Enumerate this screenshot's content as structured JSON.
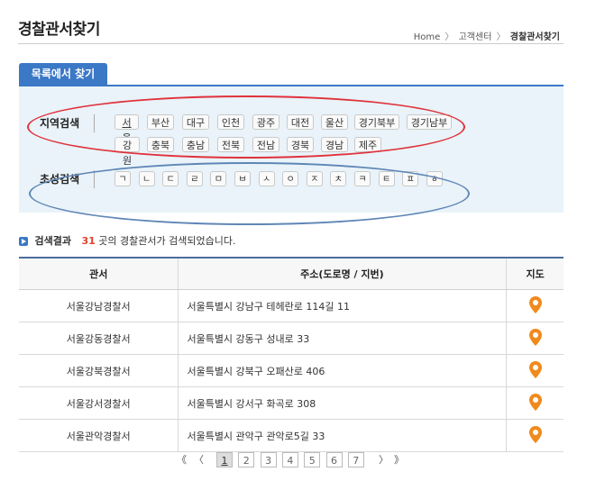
{
  "page_title": "경찰관서찾기",
  "breadcrumb": {
    "home": "Home",
    "sep1": "〉",
    "center": "고객센터",
    "sep2": "〉",
    "current": "경찰관서찾기"
  },
  "tab": {
    "label": "목록에서 찾기"
  },
  "region_search": {
    "label": "지역검색",
    "items": [
      "서울",
      "부산",
      "대구",
      "인천",
      "광주",
      "대전",
      "울산",
      "경기북부",
      "경기남부",
      "강원",
      "충북",
      "충남",
      "전북",
      "전남",
      "경북",
      "경남",
      "제주"
    ],
    "selected": "서울"
  },
  "initial_search": {
    "label": "초성검색",
    "items": [
      "ㄱ",
      "ㄴ",
      "ㄷ",
      "ㄹ",
      "ㅁ",
      "ㅂ",
      "ㅅ",
      "ㅇ",
      "ㅈ",
      "ㅊ",
      "ㅋ",
      "ㅌ",
      "ㅍ",
      "ㅎ"
    ]
  },
  "result": {
    "label": "검색결과",
    "count": "31",
    "suffix": "곳의 경찰관서가 검색되었습니다."
  },
  "table": {
    "headers": [
      "관서",
      "주소(도로명 / 지번)",
      "지도"
    ],
    "rows": [
      {
        "name": "서울강남경찰서",
        "address": "서울특별시 강남구 테헤란로 114길 11"
      },
      {
        "name": "서울강동경찰서",
        "address": "서울특별시 강동구 성내로 33"
      },
      {
        "name": "서울강북경찰서",
        "address": "서울특별시 강북구 오패산로 406"
      },
      {
        "name": "서울강서경찰서",
        "address": "서울특별시 강서구 화곡로 308"
      },
      {
        "name": "서울관악경찰서",
        "address": "서울특별시 관악구 관악로5길 33"
      }
    ]
  },
  "pagination": {
    "first": "《",
    "prev": "〈",
    "pages": [
      "1",
      "2",
      "3",
      "4",
      "5",
      "6",
      "7"
    ],
    "current": "1",
    "next": "〉",
    "last": "》"
  },
  "colors": {
    "accent": "#3b78c6",
    "pin": "#f08a1c",
    "count": "#e1402c",
    "annotation_red": "#e0323c",
    "annotation_blue": "#5f86b6"
  },
  "icons": {
    "result": "play-icon",
    "map": "map-pin-icon"
  }
}
